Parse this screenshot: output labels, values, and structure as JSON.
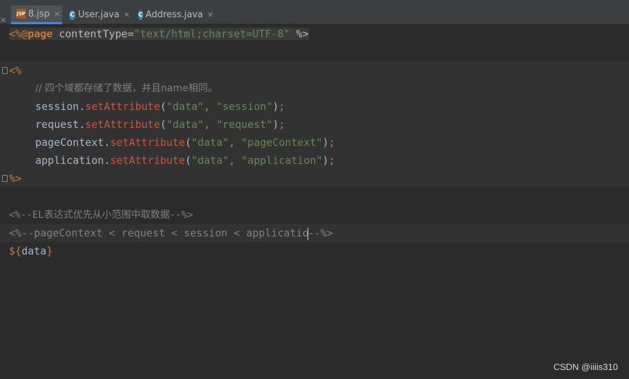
{
  "tabs": [
    {
      "label": "8.jsp",
      "icon": "jsp-file-icon",
      "active": true
    },
    {
      "label": "User.java",
      "icon": "java-class-icon",
      "active": false
    },
    {
      "label": "Address.java",
      "icon": "java-class-icon",
      "active": false
    }
  ],
  "code": {
    "line1": {
      "open": "<%@",
      "dir": "page",
      "attr": " contentType=",
      "val": "\"text/html;charset=UTF-8\"",
      "close": " %>"
    },
    "scriptlet_open": "<%",
    "comment": "// 四个域都存储了数据，并且name相同。",
    "calls": [
      {
        "obj": "session",
        "dot": ".",
        "method": "setAttribute",
        "lp": "(",
        "a1": "\"data\"",
        "sep": ", ",
        "a2": "\"session\"",
        "rp": ")",
        "semi": ";"
      },
      {
        "obj": "request",
        "dot": ".",
        "method": "setAttribute",
        "lp": "(",
        "a1": "\"data\"",
        "sep": ", ",
        "a2": "\"request\"",
        "rp": ")",
        "semi": ";"
      },
      {
        "obj": "pageContext",
        "dot": ".",
        "method": "setAttribute",
        "lp": "(",
        "a1": "\"data\"",
        "sep": ", ",
        "a2": "\"pageContext\"",
        "rp": ")",
        "semi": ";"
      },
      {
        "obj": "application",
        "dot": ".",
        "method": "setAttribute",
        "lp": "(",
        "a1": "\"data\"",
        "sep": ", ",
        "a2": "\"application\"",
        "rp": ")",
        "semi": ";"
      }
    ],
    "scriptlet_close": "%>",
    "jsp_comment1": "<%--EL表达式优先从小范围中取数据--%>",
    "jsp_comment2_a": "<%--pageContext < request < session < applicatio",
    "jsp_comment2_b": "--%>",
    "el_open": "${",
    "el_var": "data",
    "el_close": "}"
  },
  "watermark": "CSDN @iiiis310"
}
